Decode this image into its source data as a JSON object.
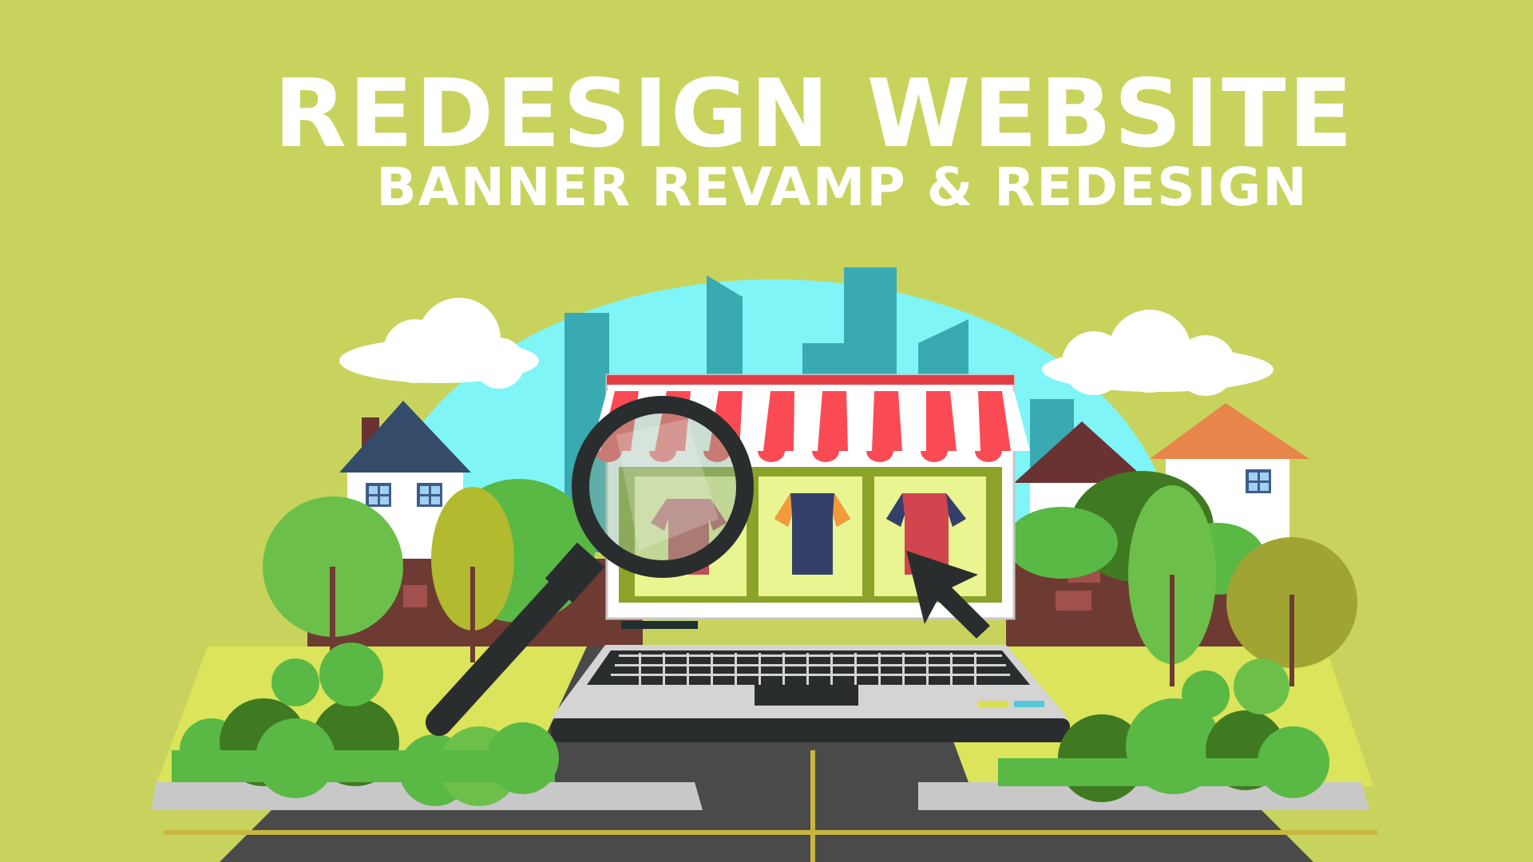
{
  "banner": {
    "title": "REDESIGN WEBSITE",
    "subtitle": "BANNER REVAMP & REDESIGN"
  },
  "colors": {
    "background": "#c8d35e",
    "sky": "#7ff5f7",
    "awning_red": "#fa4b55",
    "skyline": "#3aaab2",
    "laptop_dark": "#2a2d2e"
  },
  "icons": [
    "cloud-icon",
    "house-icon",
    "tree-icon",
    "storefront-icon",
    "laptop-icon",
    "magnifier-icon",
    "cursor-icon",
    "tshirt-icon"
  ]
}
